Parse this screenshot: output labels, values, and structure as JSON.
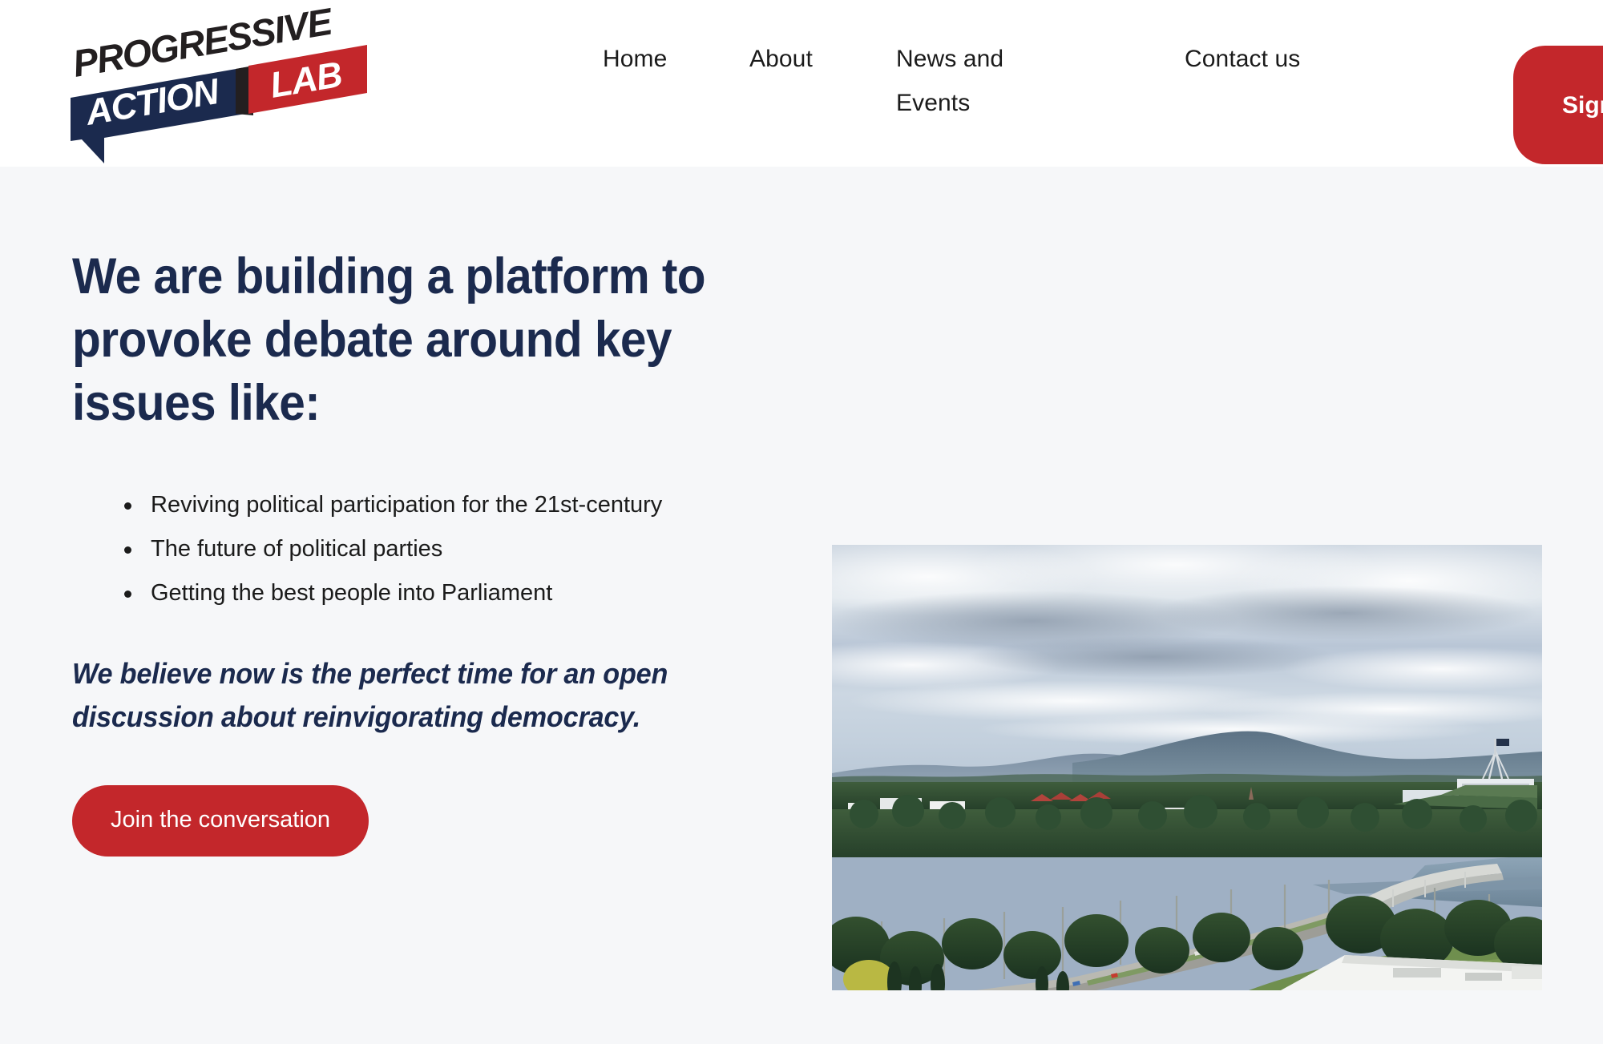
{
  "brand": {
    "logo_line1": "PROGRESSIVE",
    "logo_line2": "ACTION",
    "logo_line3": "LAB",
    "colors": {
      "red": "#c3272b",
      "navy": "#1b2a4e",
      "black": "#1b1b1b",
      "header_bg": "#ffffff",
      "hero_bg": "#f6f7f9"
    }
  },
  "nav": {
    "items": [
      {
        "label": "Home"
      },
      {
        "label": "About"
      },
      {
        "label": "News and Events"
      },
      {
        "label": "Contact us"
      }
    ],
    "signup_label": "Sign up"
  },
  "hero": {
    "title": "We are building a platform to provoke debate around key issues like:",
    "bullets": [
      "Reviving political participation for the 21st-century",
      "The future of political parties",
      "Getting the best people into Parliament"
    ],
    "statement": "We believe now is the perfect time for an open discussion about reinvigorating democracy.",
    "cta_label": "Join the conversation",
    "image_alt": "Aerial view of Canberra with Parliament House, the National Library, Lake Burley Griffin and Commonwealth Avenue Bridge under a cloudy sky"
  }
}
